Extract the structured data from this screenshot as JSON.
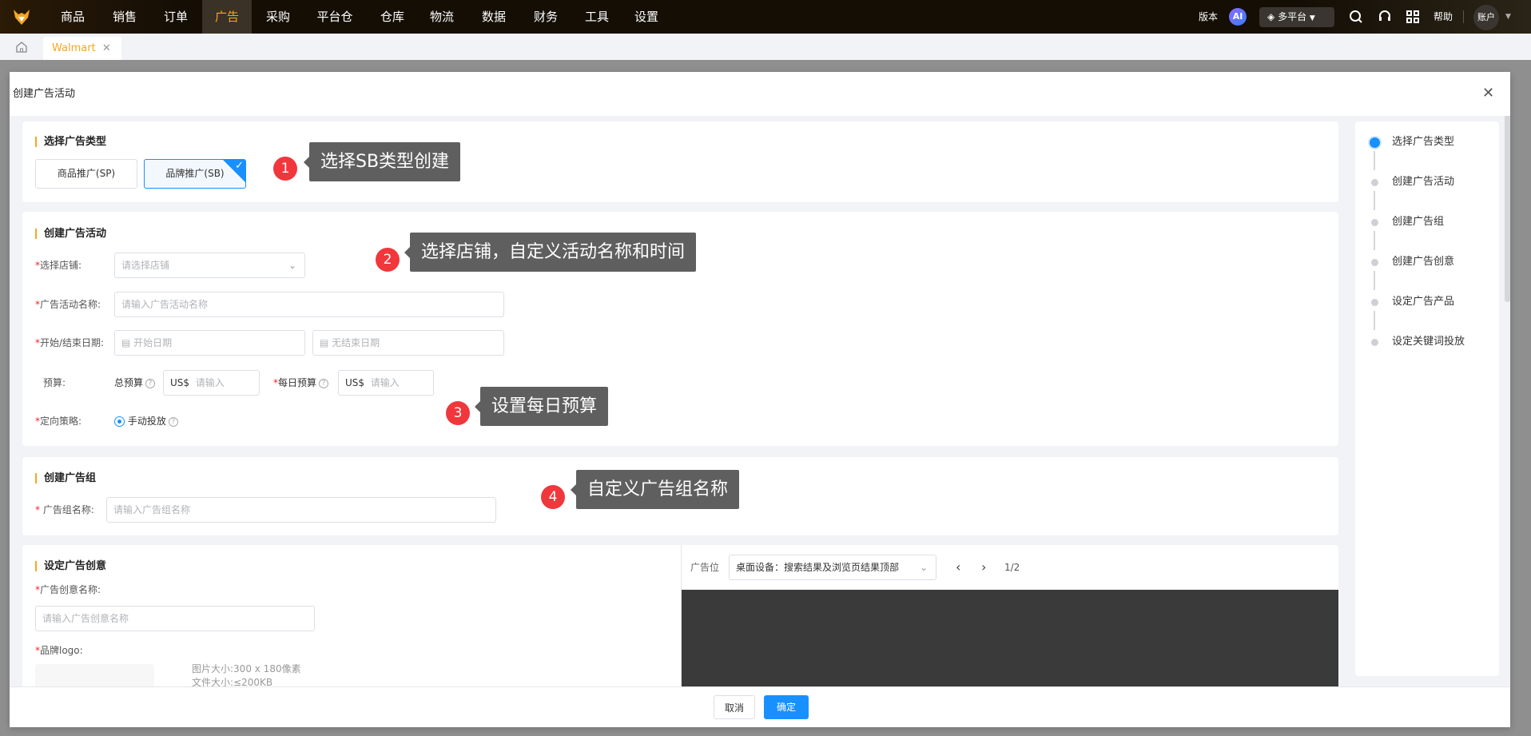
{
  "topnav": {
    "items": [
      "商品",
      "销售",
      "订单",
      "广告",
      "采购",
      "平台仓",
      "仓库",
      "物流",
      "数据",
      "财务",
      "工具",
      "设置"
    ],
    "active": "广告",
    "version": "版本",
    "ai": "AI",
    "platform": "多平台",
    "help": "帮助",
    "account": "账户"
  },
  "tabs": {
    "items": [
      {
        "label": "Walmart",
        "active": true
      }
    ]
  },
  "modal": {
    "title": "创建广告活动",
    "cancel": "取消",
    "confirm": "确定"
  },
  "section_type": {
    "title": "选择广告类型",
    "options": [
      "商品推广(SP)",
      "品牌推广(SB)"
    ],
    "selected": "品牌推广(SB)"
  },
  "section_campaign": {
    "title": "创建广告活动",
    "store_label": "选择店铺:",
    "store_placeholder": "请选择店铺",
    "name_label": "广告活动名称:",
    "name_placeholder": "请输入广告活动名称",
    "date_label": "开始/结束日期:",
    "start_placeholder": "开始日期",
    "end_placeholder": "无结束日期",
    "budget_label": "预算:",
    "total_budget_label": "总预算",
    "daily_budget_label": "每日预算",
    "currency": "US$",
    "budget_placeholder": "请输入",
    "strategy_label": "定向策略:",
    "strategy_value": "手动投放"
  },
  "section_group": {
    "title": "创建广告组",
    "name_label": "广告组名称:",
    "name_placeholder": "请输入广告组名称"
  },
  "section_creative": {
    "title": "设定广告创意",
    "name_label": "广告创意名称:",
    "name_placeholder": "请输入广告创意名称",
    "logo_label": "品牌logo:",
    "logo_hint1": "图片大小:300 x 180像素",
    "logo_hint2": "文件大小:≤200KB",
    "placement_label": "广告位",
    "placement_value": "桌面设备：搜索结果及浏览页结果顶部",
    "page": "1/2"
  },
  "steps": {
    "items": [
      "选择广告类型",
      "创建广告活动",
      "创建广告组",
      "创建广告创意",
      "设定广告产品",
      "设定关键词投放"
    ],
    "active_index": 0
  },
  "callouts": [
    {
      "num": "1",
      "text": "选择SB类型创建"
    },
    {
      "num": "2",
      "text": "选择店铺，自定义活动名称和时间"
    },
    {
      "num": "3",
      "text": "设置每日预算"
    },
    {
      "num": "4",
      "text": "自定义广告组名称"
    }
  ],
  "colors": {
    "accent": "#1890ff",
    "brand": "#f5a623",
    "required": "#f5222d",
    "callout": "#f0373c"
  }
}
